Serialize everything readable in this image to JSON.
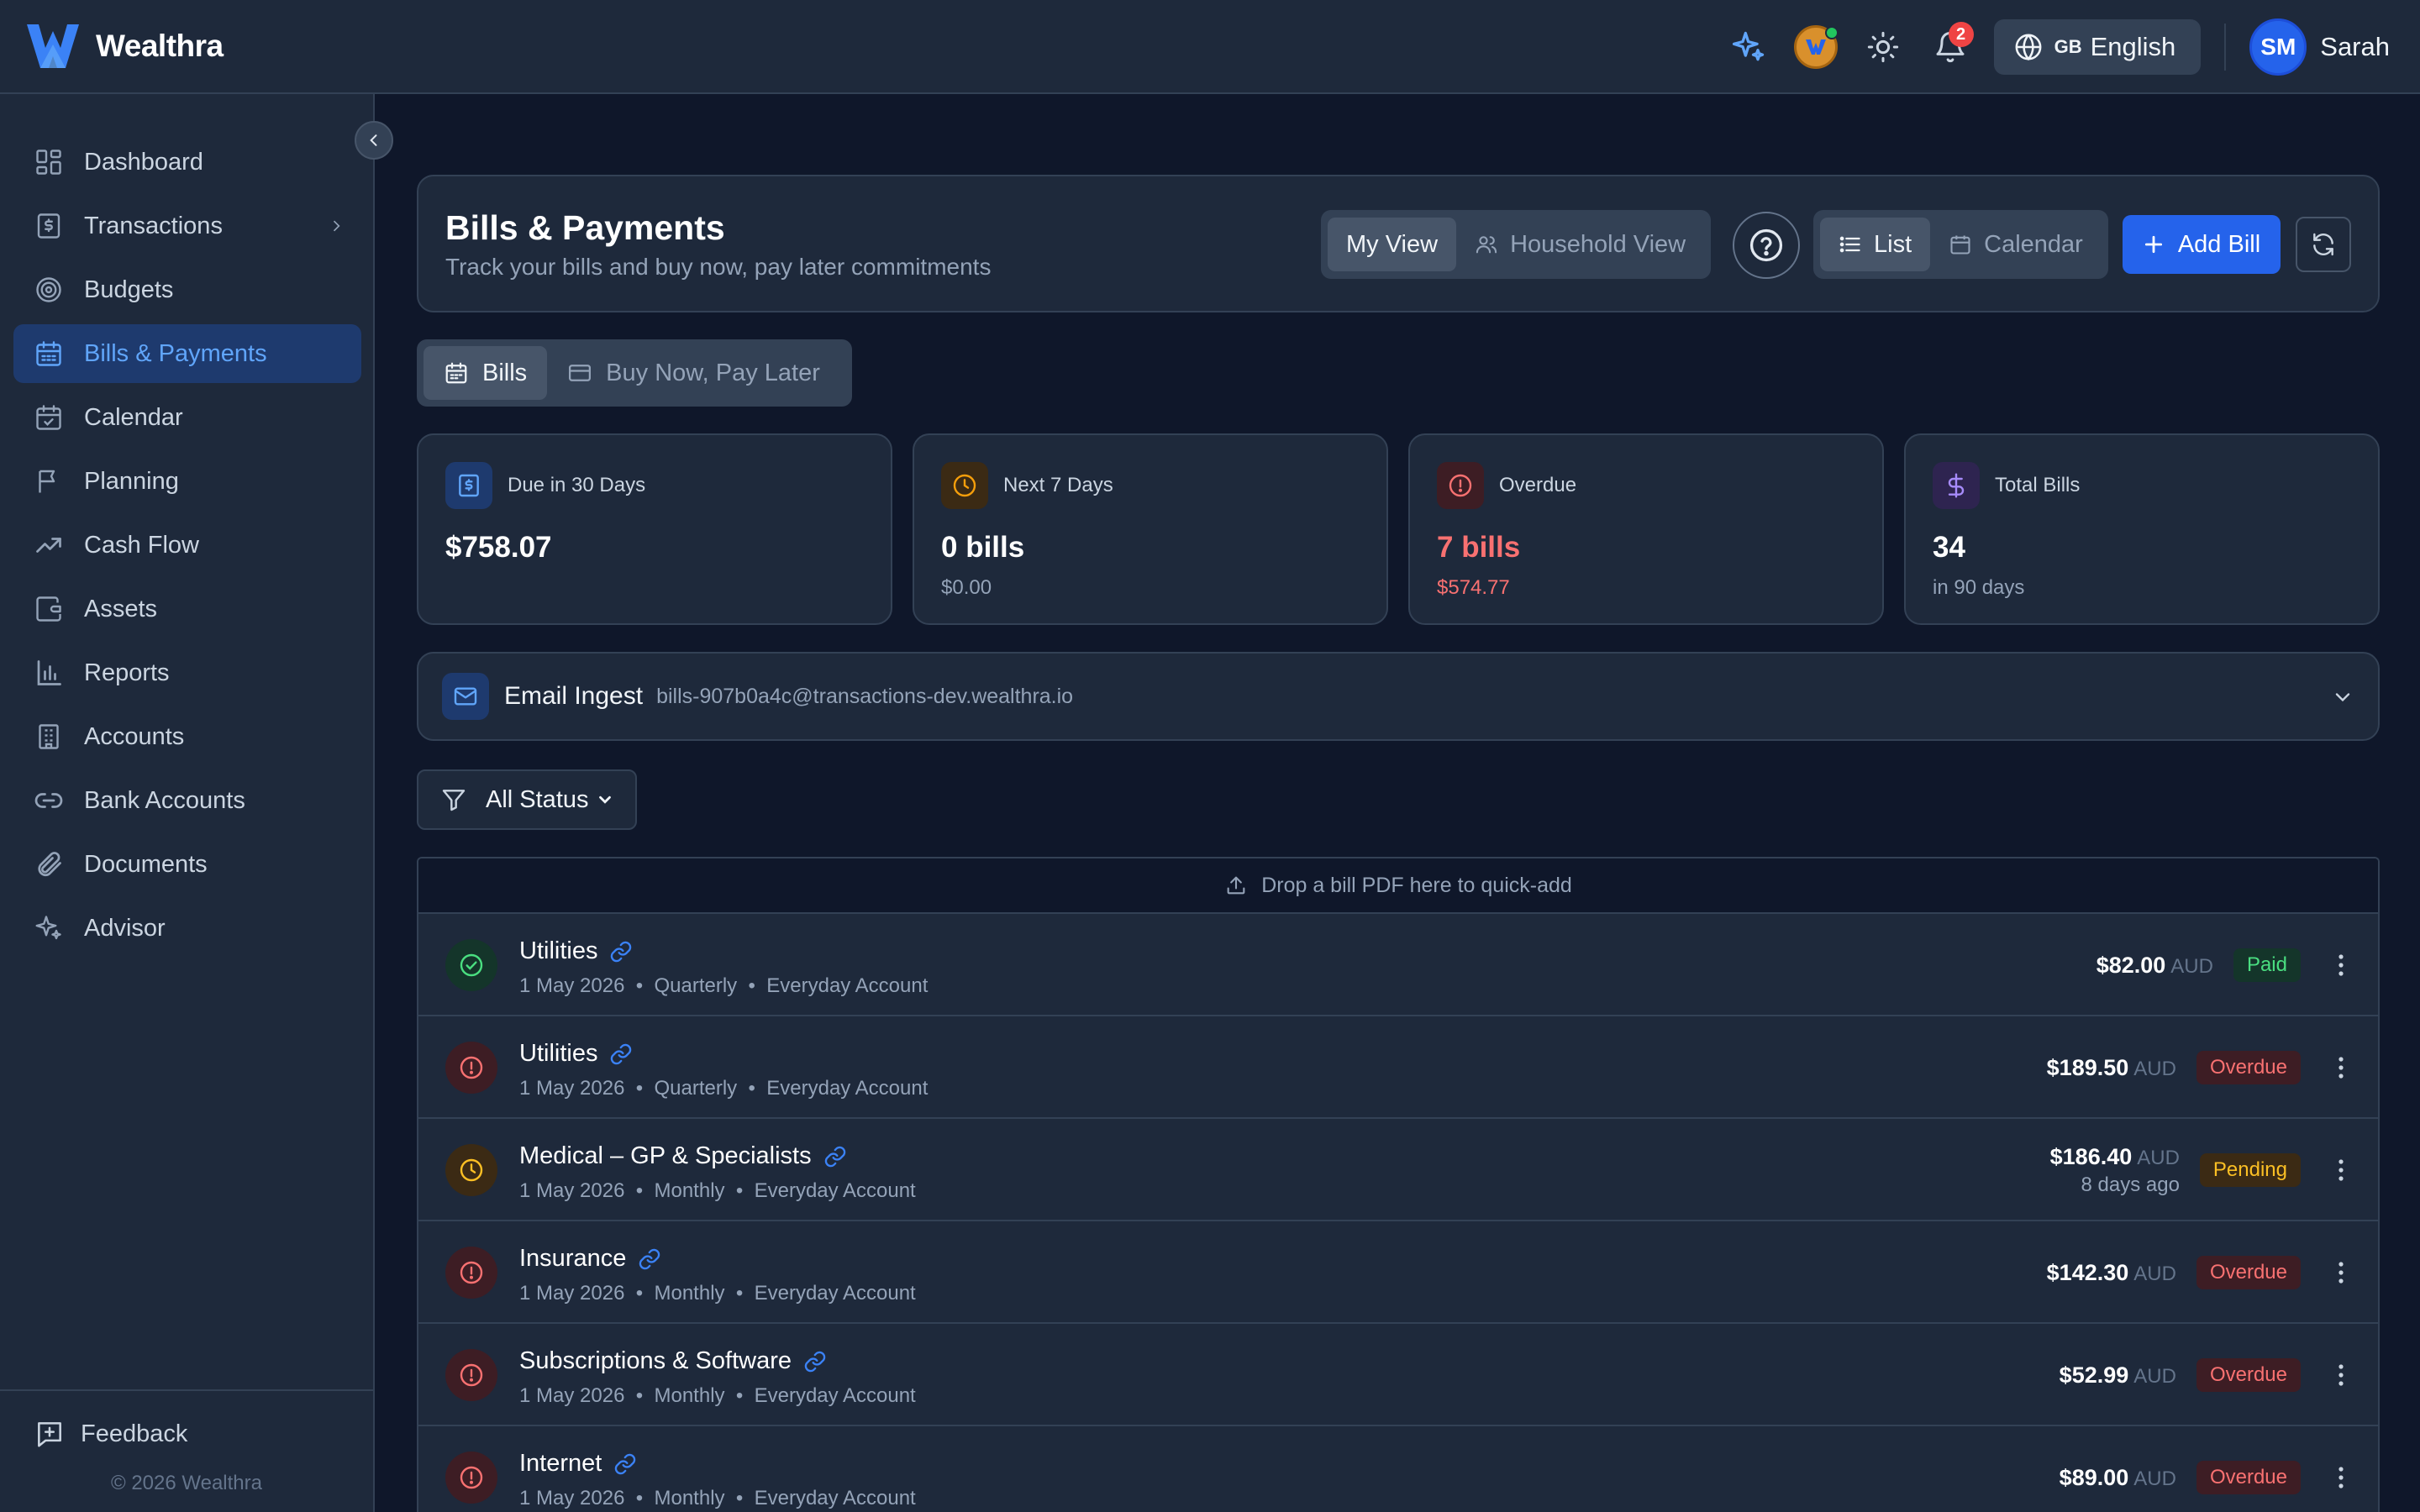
{
  "app": {
    "name": "Wealthra"
  },
  "topbar": {
    "notification_count": "2",
    "language_flag": "GB",
    "language_label": "English",
    "user_initials": "SM",
    "user_name": "Sarah"
  },
  "sidebar": {
    "items": [
      {
        "label": "Dashboard",
        "icon": "dashboard-icon"
      },
      {
        "label": "Transactions",
        "icon": "dollar-receipt-icon"
      },
      {
        "label": "Budgets",
        "icon": "target-icon"
      },
      {
        "label": "Bills & Payments",
        "icon": "calendar-icon",
        "active": true
      },
      {
        "label": "Calendar",
        "icon": "calendar-check-icon"
      },
      {
        "label": "Planning",
        "icon": "flag-icon"
      },
      {
        "label": "Cash Flow",
        "icon": "trending-up-icon"
      },
      {
        "label": "Assets",
        "icon": "wallet-icon"
      },
      {
        "label": "Reports",
        "icon": "bar-chart-icon"
      },
      {
        "label": "Accounts",
        "icon": "building-icon"
      },
      {
        "label": "Bank Accounts",
        "icon": "link-icon"
      },
      {
        "label": "Documents",
        "icon": "paperclip-icon"
      },
      {
        "label": "Advisor",
        "icon": "sparkles-icon"
      }
    ],
    "feedback_label": "Feedback",
    "copyright": "© 2026 Wealthra"
  },
  "header": {
    "title": "Bills & Payments",
    "subtitle": "Track your bills and buy now, pay later commitments",
    "view_toggle": [
      "My View",
      "Household View"
    ],
    "layout_toggle": [
      "List",
      "Calendar"
    ],
    "add_label": "Add Bill"
  },
  "tabs": [
    "Bills",
    "Buy Now, Pay Later"
  ],
  "stats": [
    {
      "label": "Due in 30 Days",
      "value": "$758.07",
      "sub": "",
      "accent": "#60a5fa"
    },
    {
      "label": "Next 7 Days",
      "value": "0 bills",
      "sub": "$0.00",
      "accent": "#f59e0b"
    },
    {
      "label": "Overdue",
      "value": "7 bills",
      "sub": "$574.77",
      "accent": "#f87171"
    },
    {
      "label": "Total Bills",
      "value": "34",
      "sub": "in 90 days",
      "accent": "#a78bfa"
    }
  ],
  "email_ingest": {
    "title": "Email Ingest",
    "address": "bills-907b0a4c@transactions-dev.wealthra.io"
  },
  "filter": {
    "label": "All Status"
  },
  "drop_zone": "Drop a bill PDF here to quick-add",
  "bills": [
    {
      "name": "Utilities",
      "meta": "1 May 2026  •  Quarterly  •  Everyday Account",
      "amount": "$82.00",
      "currency": "AUD",
      "note": "",
      "status": "Paid",
      "state": "paid"
    },
    {
      "name": "Utilities",
      "meta": "1 May 2026  •  Quarterly  •  Everyday Account",
      "amount": "$189.50",
      "currency": "AUD",
      "note": "",
      "status": "Overdue",
      "state": "overdue"
    },
    {
      "name": "Medical – GP & Specialists",
      "meta": "1 May 2026  •  Monthly  •  Everyday Account",
      "amount": "$186.40",
      "currency": "AUD",
      "note": "8 days ago",
      "status": "Pending",
      "state": "pending"
    },
    {
      "name": "Insurance",
      "meta": "1 May 2026  •  Monthly  •  Everyday Account",
      "amount": "$142.30",
      "currency": "AUD",
      "note": "",
      "status": "Overdue",
      "state": "overdue"
    },
    {
      "name": "Subscriptions & Software",
      "meta": "1 May 2026  •  Monthly  •  Everyday Account",
      "amount": "$52.99",
      "currency": "AUD",
      "note": "",
      "status": "Overdue",
      "state": "overdue"
    },
    {
      "name": "Internet",
      "meta": "1 May 2026  •  Monthly  •  Everyday Account",
      "amount": "$89.00",
      "currency": "AUD",
      "note": "",
      "status": "Overdue",
      "state": "overdue"
    }
  ],
  "colors": {
    "brand": "#3b82f6",
    "paid": "#4ade80",
    "overdue": "#f87171",
    "pending": "#fbbf24"
  }
}
